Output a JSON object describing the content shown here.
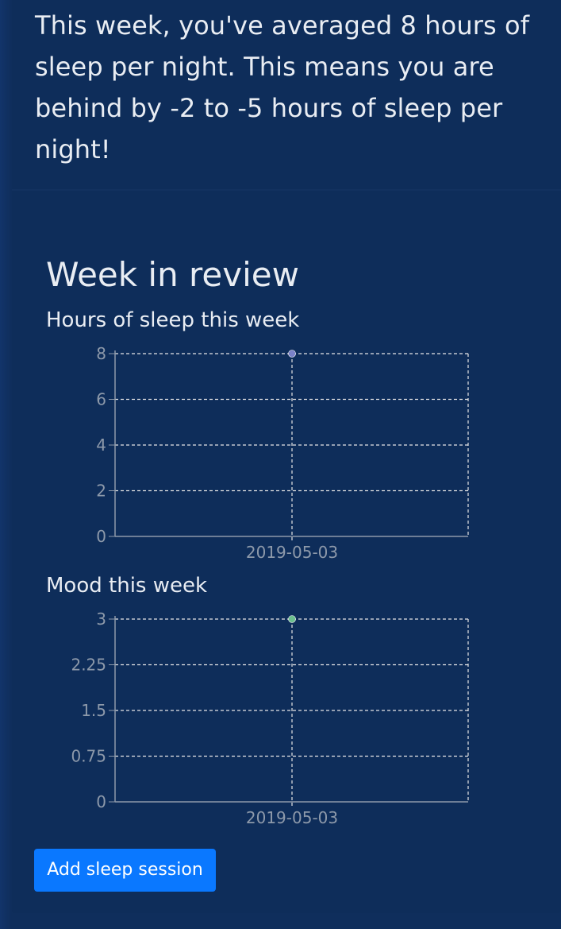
{
  "summary": {
    "text": "This week, you've averaged 8 hours of sleep per night. This means you are behind by -2 to -5 hours of sleep per night!"
  },
  "review": {
    "title": "Week in review"
  },
  "sleep_chart": {
    "title": "Hours of sleep this week"
  },
  "mood_chart": {
    "title": "Mood this week"
  },
  "actions": {
    "add_sleep_label": "Add sleep session"
  },
  "colors": {
    "background": "#0f2e5c",
    "sleep_point": "#7b82c9",
    "mood_point": "#6bbf8e",
    "button": "#0a78ff"
  },
  "chart_data": [
    {
      "type": "scatter",
      "title": "Hours of sleep this week",
      "x": [
        "2019-05-03"
      ],
      "y": [
        8
      ],
      "yticks": [
        "0",
        "2",
        "4",
        "6",
        "8"
      ],
      "ylim": [
        0,
        8
      ],
      "grid": true
    },
    {
      "type": "scatter",
      "title": "Mood this week",
      "x": [
        "2019-05-03"
      ],
      "y": [
        3
      ],
      "yticks": [
        "0",
        "0.75",
        "1.5",
        "2.25",
        "3"
      ],
      "ylim": [
        0,
        3
      ],
      "grid": true
    }
  ]
}
